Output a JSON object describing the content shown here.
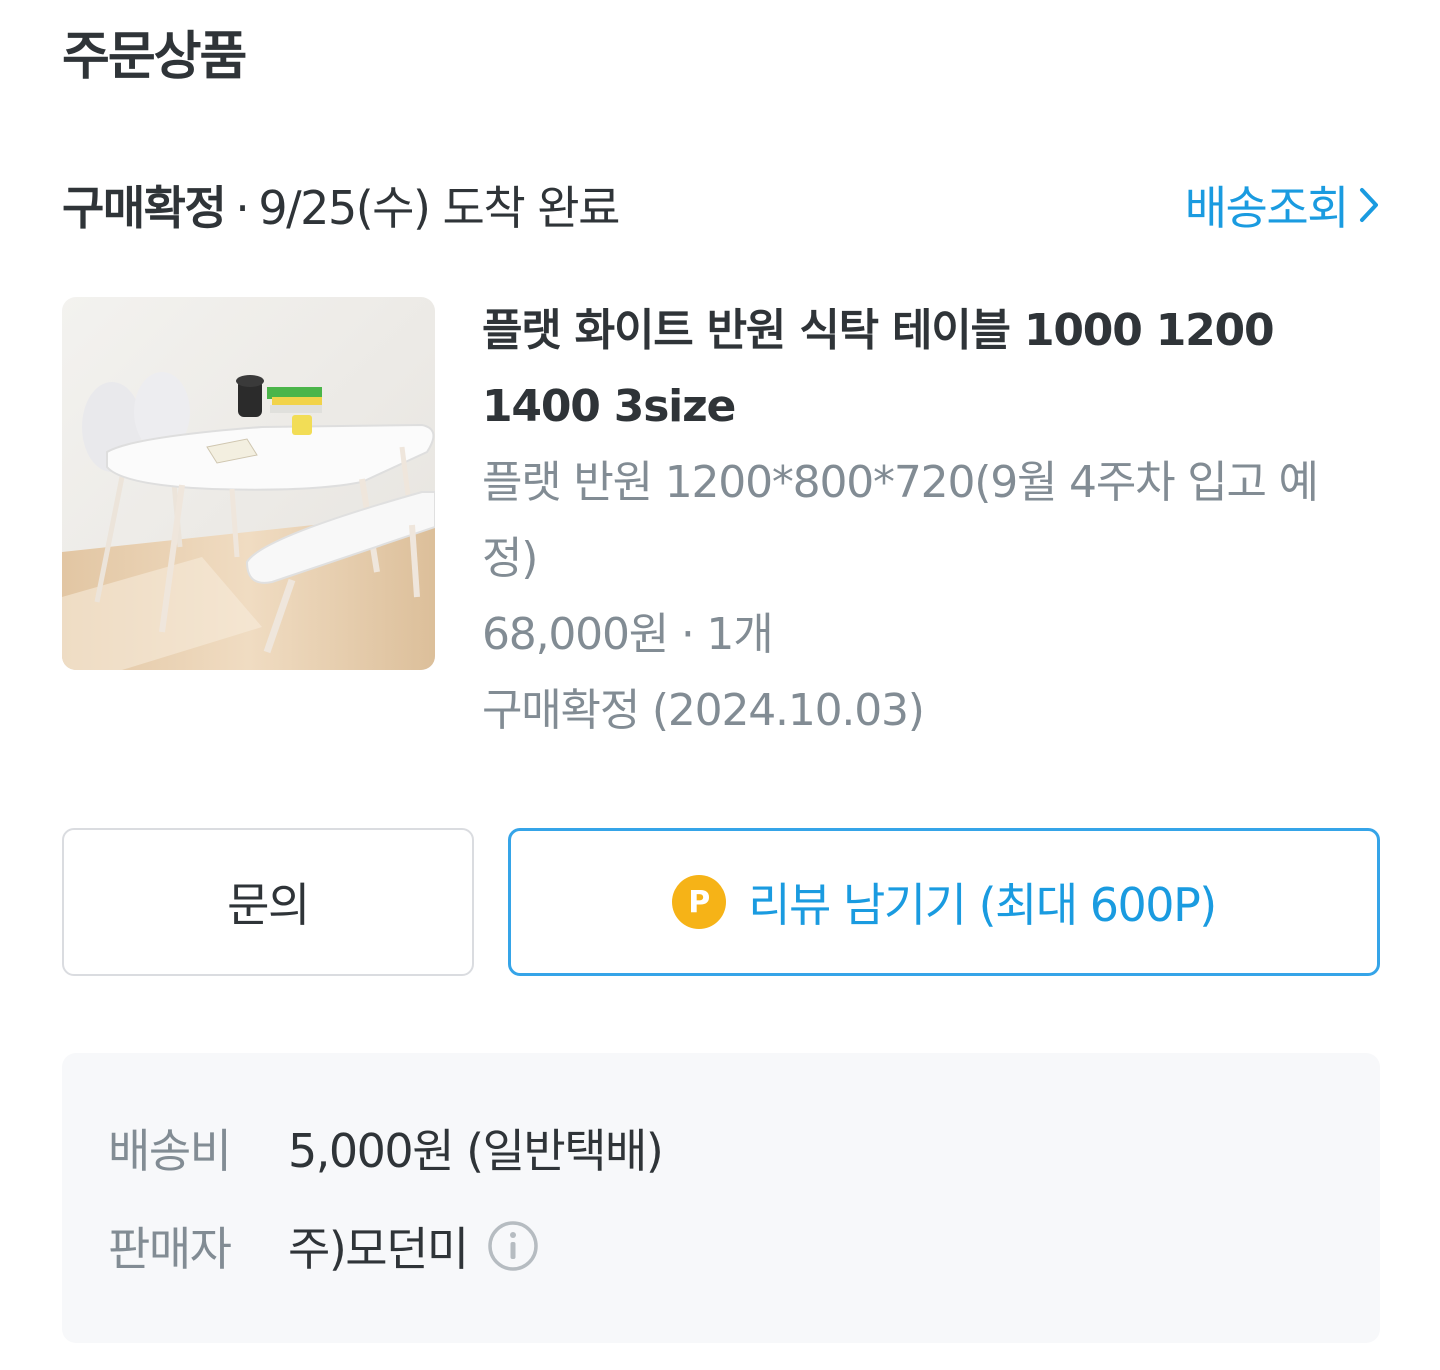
{
  "section": {
    "title": "주문상품"
  },
  "order_status": {
    "status": "구매확정",
    "separator": "·",
    "arrival": "9/25(수) 도착 완료",
    "track_label": "배송조회"
  },
  "product": {
    "name": "플랫 화이트 반원 식탁 테이블 1000 1200 1400 3size",
    "option": "플랫 반원 1200*800*720(9월 4주차 입고 예정)",
    "price_qty": "68,000원 · 1개",
    "status": "구매확정 (2024.10.03)"
  },
  "actions": {
    "inquiry_label": "문의",
    "review_badge": "P",
    "review_label": "리뷰 남기기 (최대 600P)"
  },
  "delivery": {
    "fee_label": "배송비",
    "fee_value": "5,000원 (일반택배)",
    "seller_label": "판매자",
    "seller_value": "주)모던미"
  },
  "colors": {
    "accent": "#1a9be0",
    "point_badge": "#f6b317",
    "muted_text": "#828c94",
    "info_box_bg": "#f7f8fa"
  },
  "icons": [
    "chevron-right-icon",
    "point-badge-icon",
    "info-icon"
  ]
}
